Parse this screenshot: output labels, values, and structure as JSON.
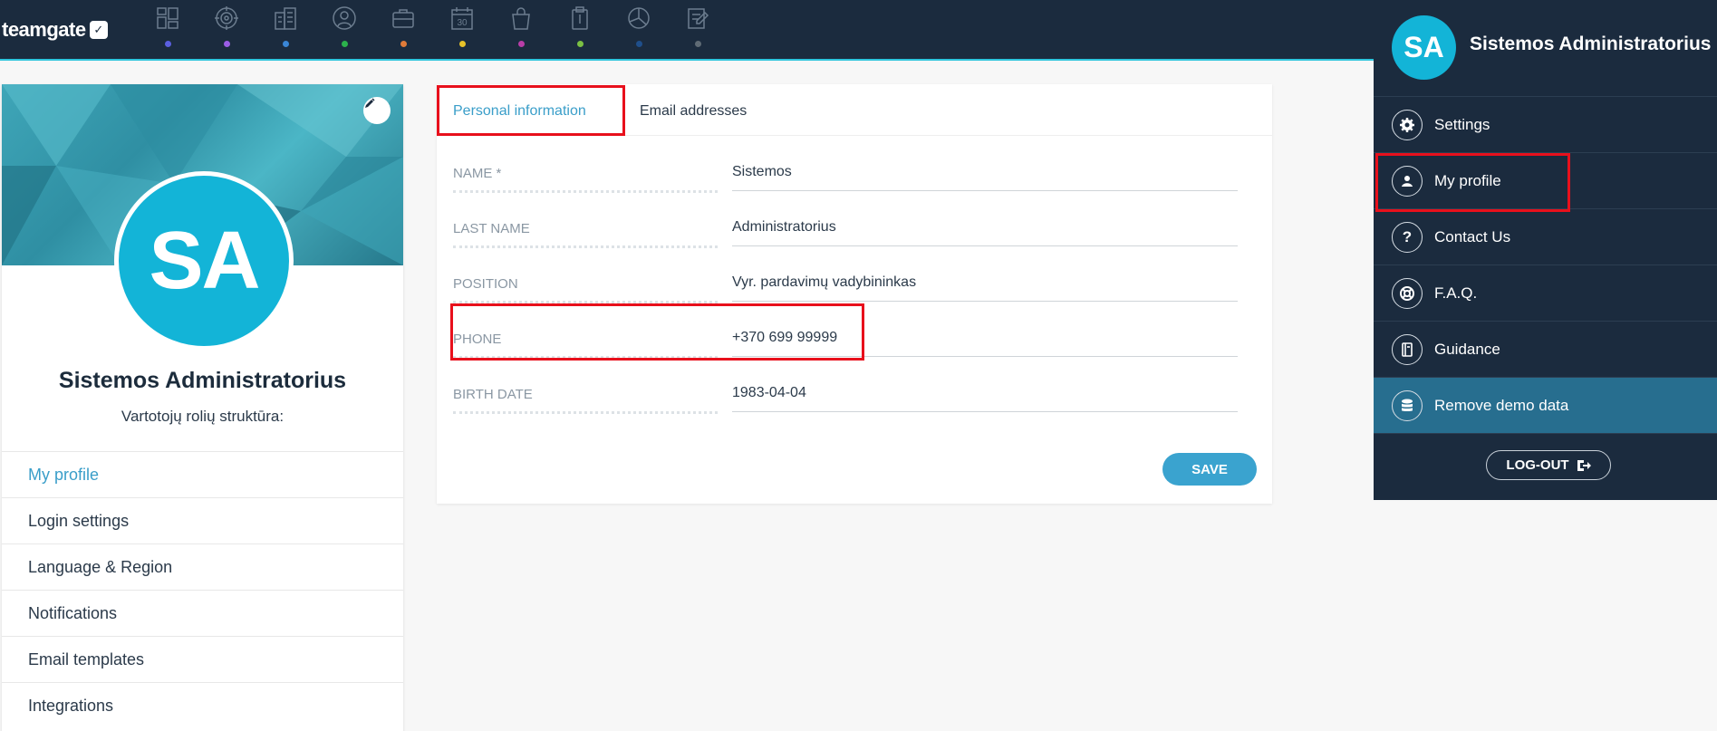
{
  "app": {
    "logo_text": "teamgate"
  },
  "top_nav": {
    "icons": [
      {
        "name": "dashboard-icon",
        "dot": "#5b5fe0"
      },
      {
        "name": "target-icon",
        "dot": "#9b5de5"
      },
      {
        "name": "buildings-icon",
        "dot": "#3a86d6"
      },
      {
        "name": "contacts-icon",
        "dot": "#2bb24c"
      },
      {
        "name": "briefcase-icon",
        "dot": "#e07b39"
      },
      {
        "name": "calendar-icon",
        "dot": "#e6c229"
      },
      {
        "name": "shopping-bag-icon",
        "dot": "#b83ea8"
      },
      {
        "name": "clipboard-icon",
        "dot": "#7bc043"
      },
      {
        "name": "pie-chart-icon",
        "dot": "#1f4f8b"
      },
      {
        "name": "notes-icon",
        "dot": "#5f6b75"
      }
    ],
    "calendar_number": "30"
  },
  "profile_card": {
    "initials": "SA",
    "name": "Sistemos Administratorius",
    "role": "Vartotojų rolių struktūra:",
    "menu": [
      {
        "label": "My profile",
        "active": true
      },
      {
        "label": "Login settings",
        "active": false
      },
      {
        "label": "Language & Region",
        "active": false
      },
      {
        "label": "Notifications",
        "active": false
      },
      {
        "label": "Email templates",
        "active": false
      },
      {
        "label": "Integrations",
        "active": false
      }
    ]
  },
  "form": {
    "tabs": [
      {
        "label": "Personal information",
        "active": true
      },
      {
        "label": "Email addresses",
        "active": false
      }
    ],
    "fields": [
      {
        "label": "NAME *",
        "value": "Sistemos"
      },
      {
        "label": "LAST NAME",
        "value": "Administratorius"
      },
      {
        "label": "POSITION",
        "value": "Vyr. pardavimų vadybininkas"
      },
      {
        "label": "PHONE",
        "value": "+370 699 99999"
      },
      {
        "label": "BIRTH DATE",
        "value": "1983-04-04"
      }
    ],
    "save_label": "SAVE"
  },
  "user_menu": {
    "initials": "SA",
    "name": "Sistemos Administratorius",
    "items": [
      {
        "label": "Settings",
        "icon": "gear-icon"
      },
      {
        "label": "My profile",
        "icon": "profile-icon"
      },
      {
        "label": "Contact Us",
        "icon": "question-icon"
      },
      {
        "label": "F.A.Q.",
        "icon": "lifebuoy-icon"
      },
      {
        "label": "Guidance",
        "icon": "book-icon"
      },
      {
        "label": "Remove demo data",
        "icon": "database-icon"
      }
    ],
    "logout_label": "LOG-OUT"
  },
  "colors": {
    "topbar": "#1b2b3e",
    "accent": "#3a9ec9",
    "avatar": "#13b4d7",
    "annotation": "#e8101c"
  }
}
